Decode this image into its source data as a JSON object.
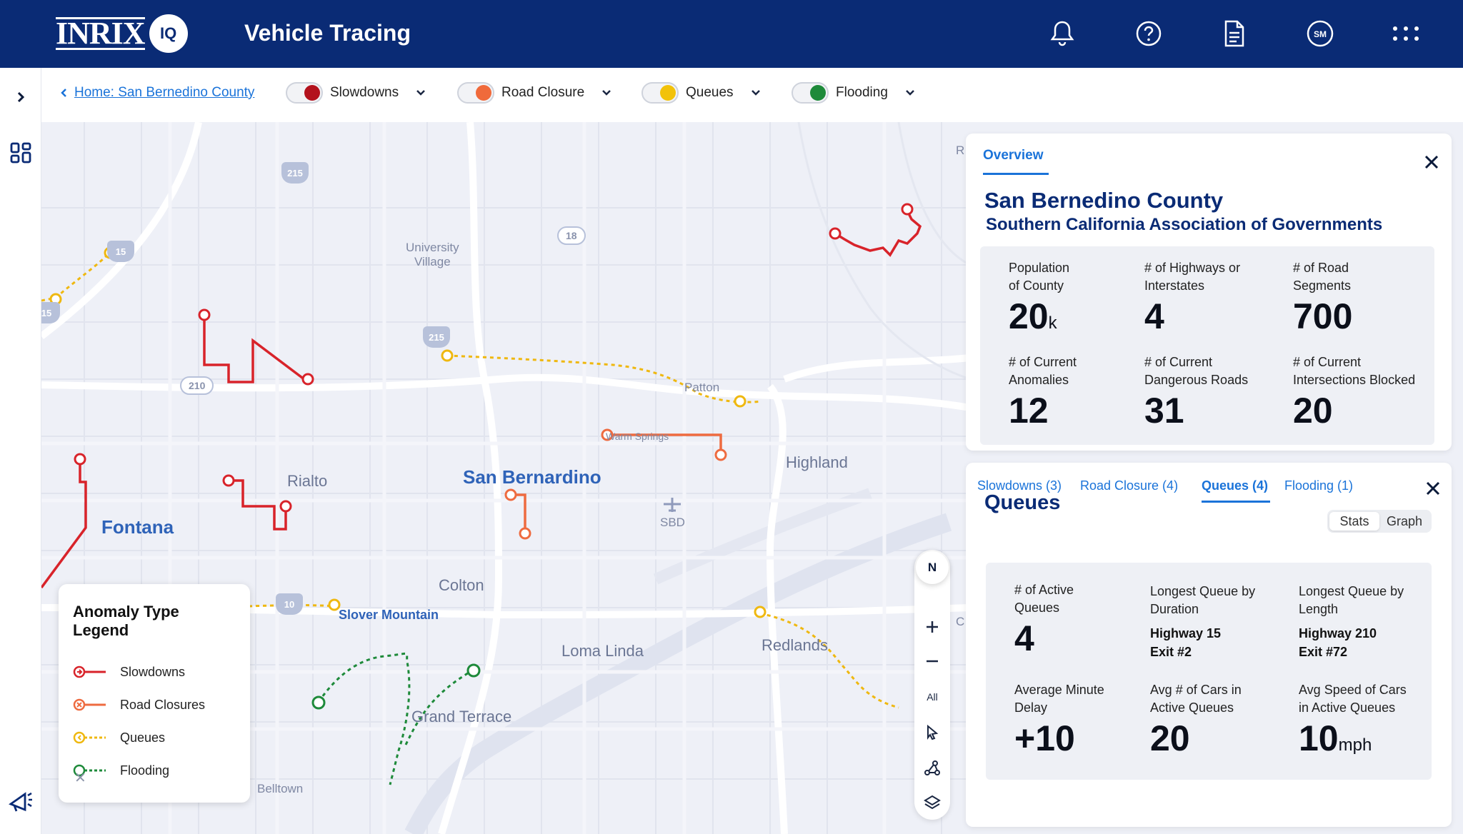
{
  "header": {
    "logo_text": "INRIX",
    "logo_badge": "IQ",
    "title": "Vehicle Tracing",
    "user_initials": "SM",
    "icons": [
      "bell-icon",
      "help-icon",
      "document-icon",
      "user-avatar",
      "apps-grid-icon"
    ]
  },
  "filters": {
    "breadcrumb": "Home: San Bernedino County",
    "toggles": [
      {
        "label": "Slowdowns",
        "color": "#b3121d"
      },
      {
        "label": "Road Closure",
        "color": "#f06a3b"
      },
      {
        "label": "Queues",
        "color": "#f2c20a"
      },
      {
        "label": "Flooding",
        "color": "#1e8a3a"
      }
    ]
  },
  "map": {
    "labels": {
      "fontana": "Fontana",
      "rialto": "Rialto",
      "san_bernardino": "San Bernardino",
      "highland": "Highland",
      "colton": "Colton",
      "loma_linda": "Loma Linda",
      "redlands": "Redlands",
      "grand_terrace": "Grand Terrace",
      "slover_mountain": "Slover Mountain",
      "university_village": "University\nVillage",
      "patton": "Patton",
      "warm_springs": "Warm Springs",
      "sbd": "SBD",
      "belltown": "Belltown",
      "edge_r": "R",
      "edge_c": "C"
    },
    "shields": {
      "i215a": "215",
      "i215b": "215",
      "i15a": "15",
      "i15b": "15",
      "i10": "10"
    },
    "ovals": {
      "r18": "18",
      "r210": "210"
    },
    "controls": {
      "compass": "N",
      "all": "All"
    }
  },
  "legend": {
    "title": "Anomaly Type Legend",
    "items": [
      {
        "label": "Slowdowns",
        "color": "#d8232a"
      },
      {
        "label": "Road Closures",
        "color": "#ee6b40"
      },
      {
        "label": "Queues",
        "color": "#efb810"
      },
      {
        "label": "Flooding",
        "color": "#1e8a3a"
      }
    ]
  },
  "overview": {
    "tab": "Overview",
    "county": "San Bernedino County",
    "association": "Southern California Association of Governments",
    "stats": [
      {
        "label": "Population\nof County",
        "value": "20",
        "unit": "k"
      },
      {
        "label": "# of Highways or\nInterstates",
        "value": "4",
        "unit": ""
      },
      {
        "label": "# of Road\nSegments",
        "value": "700",
        "unit": ""
      },
      {
        "label": "# of Current\nAnomalies",
        "value": "12",
        "unit": ""
      },
      {
        "label": "# of Current\nDangerous Roads",
        "value": "31",
        "unit": ""
      },
      {
        "label": "# of Current\nIntersections Blocked",
        "value": "20",
        "unit": ""
      }
    ]
  },
  "queues": {
    "tabs": [
      "Slowdowns (3)",
      "Road Closure (4)",
      "Queues (4)",
      "Flooding (1)"
    ],
    "title": "Queues",
    "view_toggle": [
      "Stats",
      "Graph"
    ],
    "stats": {
      "active_label": "# of Active\nQueues",
      "active_value": "4",
      "longest_duration_label": "Longest Queue by\nDuration",
      "longest_duration_value": "Highway 15\nExit #2",
      "longest_length_label": "Longest Queue by\nLength",
      "longest_length_value": "Highway 210\nExit #72",
      "delay_label": "Average Minute\nDelay",
      "delay_value": "+10",
      "cars_label": "Avg # of Cars in\nActive Queues",
      "cars_value": "20",
      "speed_label": "Avg Speed of Cars\nin Active Queues",
      "speed_value": "10",
      "speed_unit": "mph"
    }
  }
}
